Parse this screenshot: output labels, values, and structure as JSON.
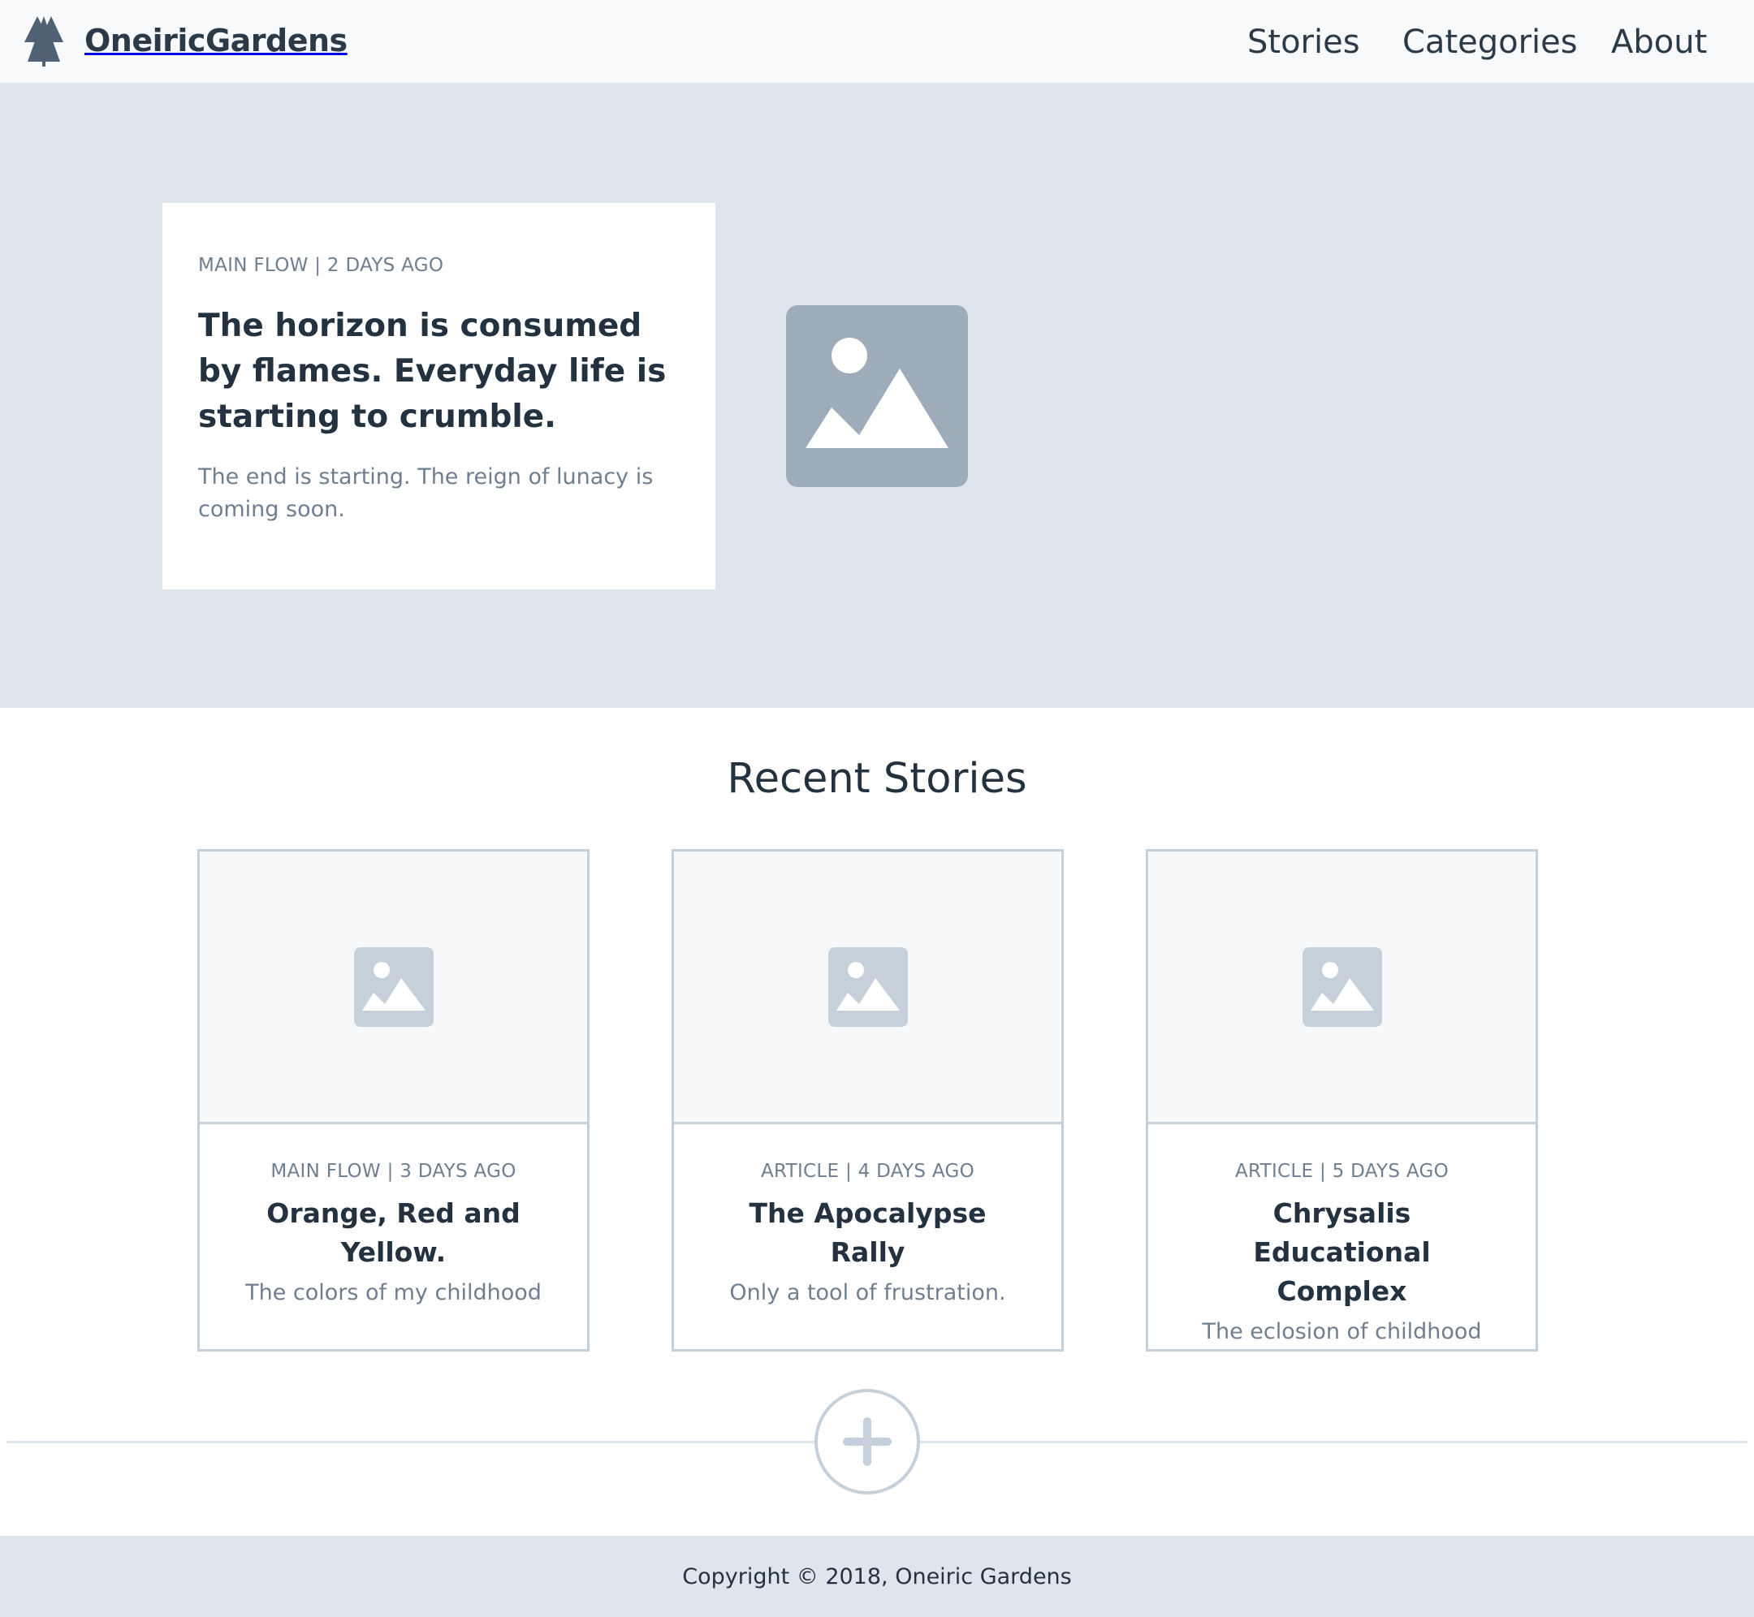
{
  "header": {
    "brand_name": "OneiricGardens",
    "logo_icon": "tree-icon",
    "nav": [
      {
        "label": "Stories"
      },
      {
        "label": "Categories"
      },
      {
        "label": "About"
      }
    ]
  },
  "hero": {
    "meta": "MAIN FLOW | 2 DAYS AGO",
    "title": "The horizon is consumed by flames. Everyday life is starting to crumble.",
    "summary": "The end is starting. The reign of lunacy is coming soon.",
    "image_icon": "image-placeholder-icon"
  },
  "recent": {
    "heading": "Recent Stories",
    "stories": [
      {
        "meta": "MAIN FLOW | 3 DAYS AGO",
        "title": "Orange, Red and Yellow.",
        "subtitle": "The colors of my childhood"
      },
      {
        "meta": "ARTICLE | 4 DAYS AGO",
        "title": "The Apocalypse Rally",
        "subtitle": "Only a tool of frustration."
      },
      {
        "meta": "ARTICLE | 5 DAYS AGO",
        "title": "Chrysalis Educational Complex",
        "subtitle": "The eclosion of childhood"
      }
    ],
    "load_more_icon": "plus-icon"
  },
  "footer": {
    "copyright": "Copyright © 2018, Oneiric Gardens"
  },
  "colors": {
    "header_bg": "#f7f9fb",
    "hero_bg": "#dfe5ed",
    "text_dark": "#243240",
    "text_muted": "#6f7f90",
    "border": "#c5d0da"
  }
}
